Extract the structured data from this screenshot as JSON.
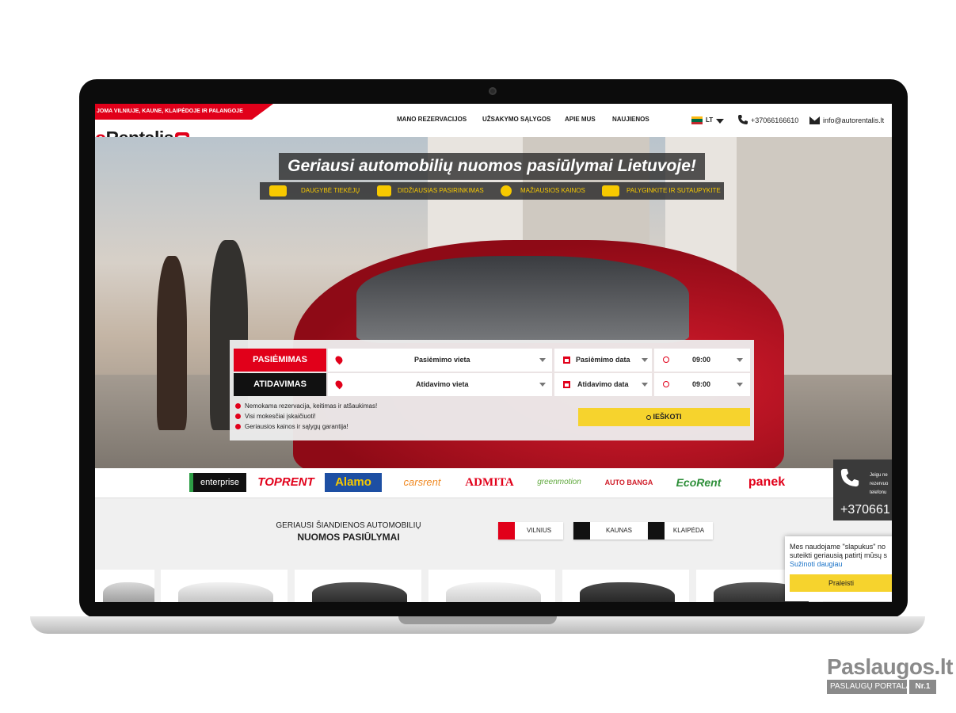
{
  "promo_text": "JOMA VILNIUJE, KAUNE, KLAIPĖDOJE IR PALANGOJE",
  "logo": {
    "prefix": "o",
    "text": "Rentalis"
  },
  "nav": {
    "reservations": "MANO REZERVACIJOS",
    "conditions": "UŽSAKYMO SĄLYGOS",
    "about": "APIE MUS",
    "news": "NAUJIENOS"
  },
  "lang": "LT",
  "contact": {
    "phone": "+37066166610",
    "email": "info@autorentalis.lt"
  },
  "hero": {
    "title": "Geriausi automobilių nuomos pasiūlymai Lietuvoje!",
    "features": [
      {
        "label": "DAUGYBĖ TIEKĖJŲ",
        "icon": "car-icon"
      },
      {
        "label": "DIDŽIAUSIAS PASIRINKIMAS",
        "icon": "list-icon"
      },
      {
        "label": "MAŽIAUSIOS KAINOS",
        "icon": "percent-icon"
      },
      {
        "label": "PALYGINKITE IR SUTAUPYKITE",
        "icon": "scales-icon"
      }
    ]
  },
  "search": {
    "pickup_label": "PASIĖMIMAS",
    "dropoff_label": "ATIDAVIMAS",
    "pickup_location": "Pasiėmimo vieta",
    "dropoff_location": "Atidavimo vieta",
    "pickup_date": "Pasiėmimo data",
    "dropoff_date": "Atidavimo data",
    "pickup_time": "09:00",
    "dropoff_time": "09:00",
    "bullets": [
      "Nemokama rezervacija, keitimas ir atšaukimas!",
      "Visi mokesčiai įskaičiuoti!",
      "Geriausios kainos ir sąlygų garantija!"
    ],
    "button": "IEŠKOTI"
  },
  "brands": [
    "enterprise",
    "TOPRENT",
    "Alamo",
    "carsrent",
    "ADMITA",
    "greenmotion",
    "AUTO BANGA",
    "EcoRent",
    "panek"
  ],
  "phone_widget": {
    "text": "Jeigu ne rezervuo telefonu",
    "number": "+370661"
  },
  "deals": {
    "title_line1": "GERIAUSI ŠIANDIENOS AUTOMOBILIŲ",
    "title_line2": "NUOMOS PASIŪLYMAI",
    "cities": [
      "VILNIUS",
      "KAUNAS",
      "KLAIPĖDA"
    ]
  },
  "cookie": {
    "text": "Mes naudojame \"slapukus\" no suteikti geriausią patirtį mūsų s",
    "link": "Sužinoti daugiau",
    "button": "Praleisti"
  },
  "watermark": {
    "main": "Paslaugos.lt",
    "sub": "PASLAUGŲ PORTALAS",
    "badge": "Nr.1"
  },
  "colors": {
    "accent": "#e1001a",
    "yellow": "#f6d32d",
    "dark": "#1a1a1a"
  }
}
